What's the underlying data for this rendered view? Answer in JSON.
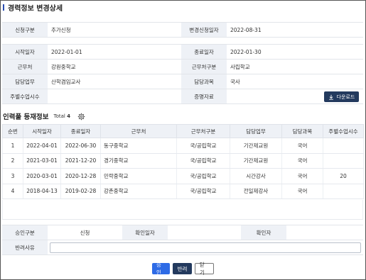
{
  "header": {
    "title": "경력정보 변경상세"
  },
  "request": {
    "type_label": "신청구분",
    "type_value": "추가신청",
    "date_label": "변경신청일자",
    "date_value": "2022-08-31"
  },
  "career": {
    "start_label": "시작일자",
    "start_value": "2022-01-01",
    "end_label": "종료일자",
    "end_value": "2022-01-30",
    "workplace_label": "근무처",
    "workplace_value": "강원중학교",
    "workplace_type_label": "근무처구분",
    "workplace_type_value": "사립학교",
    "duty_label": "담당업무",
    "duty_value": "산학겸임교사",
    "subject_label": "담당과목",
    "subject_value": "국사",
    "weekly_hours_label": "주별수업시수",
    "weekly_hours_value": "",
    "proof_label": "증명자료",
    "download_label": "다운로드"
  },
  "registry": {
    "title": "인력풀 등재정보",
    "total_label": "Total",
    "total_count": "4",
    "columns": [
      "순번",
      "시작일자",
      "종료일자",
      "근무처",
      "근무처구분",
      "담당업무",
      "담당과목",
      "주별수업시수"
    ],
    "rows": [
      {
        "no": "1",
        "start": "2022-04-01",
        "end": "2022-06-30",
        "workplace": "동구중학교",
        "wtype": "국/공립학교",
        "duty": "기간제교원",
        "subject": "국어",
        "hours": ""
      },
      {
        "no": "2",
        "start": "2021-03-01",
        "end": "2021-12-20",
        "workplace": "경기중학교",
        "wtype": "국/공립학교",
        "duty": "기간제교원",
        "subject": "국어",
        "hours": ""
      },
      {
        "no": "3",
        "start": "2020-03-01",
        "end": "2020-12-28",
        "workplace": "민락중학교",
        "wtype": "국/공립학교",
        "duty": "시간강사",
        "subject": "국어",
        "hours": "20"
      },
      {
        "no": "4",
        "start": "2018-04-13",
        "end": "2019-02-28",
        "workplace": "강촌중학교",
        "wtype": "국/공립학교",
        "duty": "전일제강사",
        "subject": "국어",
        "hours": ""
      }
    ]
  },
  "approval": {
    "status_label": "승인구분",
    "status_value": "신청",
    "confirm_date_label": "확인일자",
    "confirm_date_value": "",
    "confirmer_label": "확인자",
    "confirmer_value": "",
    "reason_label": "반려사유",
    "reason_value": ""
  },
  "buttons": {
    "approve": "승인",
    "reject": "반려",
    "close": "닫기"
  },
  "colors": {
    "accent": "#2e6be6",
    "navy": "#233a5e",
    "label_bg": "#eef1f6"
  }
}
